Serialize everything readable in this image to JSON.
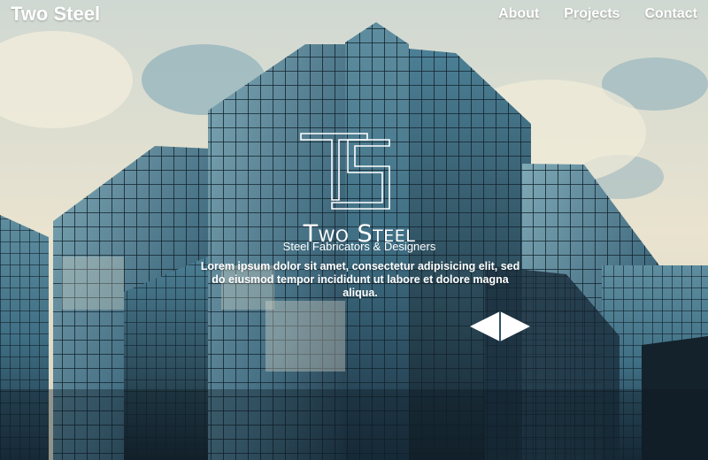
{
  "header": {
    "brand": "Two Steel",
    "nav": [
      {
        "label": "About"
      },
      {
        "label": "Projects"
      },
      {
        "label": "Contact"
      }
    ]
  },
  "hero": {
    "logo_monogram": "TS",
    "logo_title": "Two Steel",
    "logo_subtitle": "Steel Fabricators & Designers",
    "intro_text": "Lorem ipsum dolor sit amet, consectetur adipisicing elit, sed do eiusmod tempor incididunt ut labore et dolore magna aliqua.",
    "control_icon": "double-arrow-icon"
  },
  "colors": {
    "text": "#ffffff",
    "sky": "#e8e2cf",
    "glass": "#3c6a80",
    "glass_dark": "#1c3140"
  }
}
